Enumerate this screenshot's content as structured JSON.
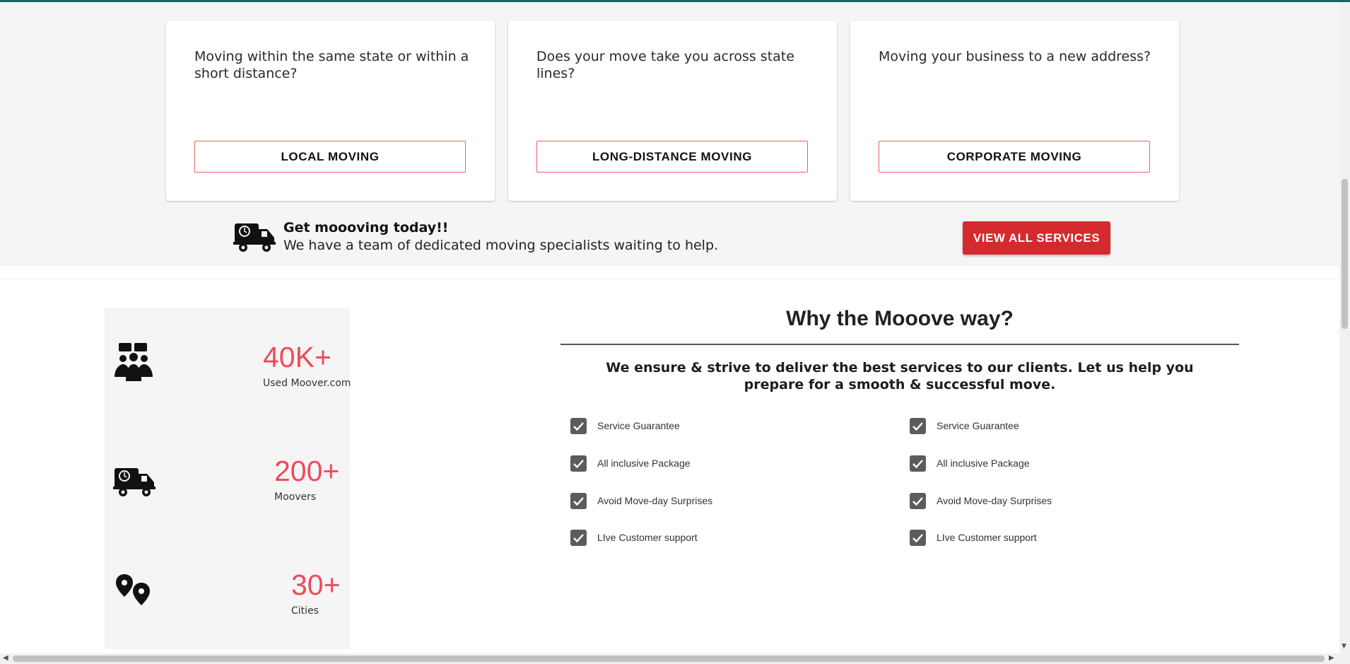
{
  "services": {
    "cards": [
      {
        "question": "Moving within the same state or within a short distance?",
        "button": "LOCAL MOVING"
      },
      {
        "question": "Does your move take you across state lines?",
        "button": "LONG-DISTANCE MOVING"
      },
      {
        "question": "Moving your business to a new address?",
        "button": "CORPORATE MOVING"
      }
    ],
    "promo": {
      "title": "Get moooving today!!",
      "subtitle": "We have a team of dedicated moving specialists waiting to help.",
      "icon": "moving-truck-icon"
    },
    "view_all_label": "VIEW ALL SERVICES"
  },
  "stats": [
    {
      "value": "40K+",
      "label": "Used Moover.com",
      "icon": "team-icon"
    },
    {
      "value": "200+",
      "label": "Moovers",
      "icon": "moving-truck-icon"
    },
    {
      "value": "30+",
      "label": "Cities",
      "icon": "map-pins-icon"
    }
  ],
  "why": {
    "title": "Why the Mooove way?",
    "subtitle": "We ensure & strive to deliver the best services to our clients. Let us help you prepare for a smooth & successful move.",
    "features_left": [
      "Service Guarantee",
      "All inclusive Package",
      "Avoid Move-day Surprises",
      "LIve Customer support"
    ],
    "features_right": [
      "Service Guarantee",
      "All inclusive Package",
      "Avoid Move-day Surprises",
      "LIve Customer support"
    ]
  },
  "colors": {
    "accent_red": "#d42a2d",
    "stat_pink": "#ee4b5a",
    "top_bar": "#0f6b63"
  }
}
